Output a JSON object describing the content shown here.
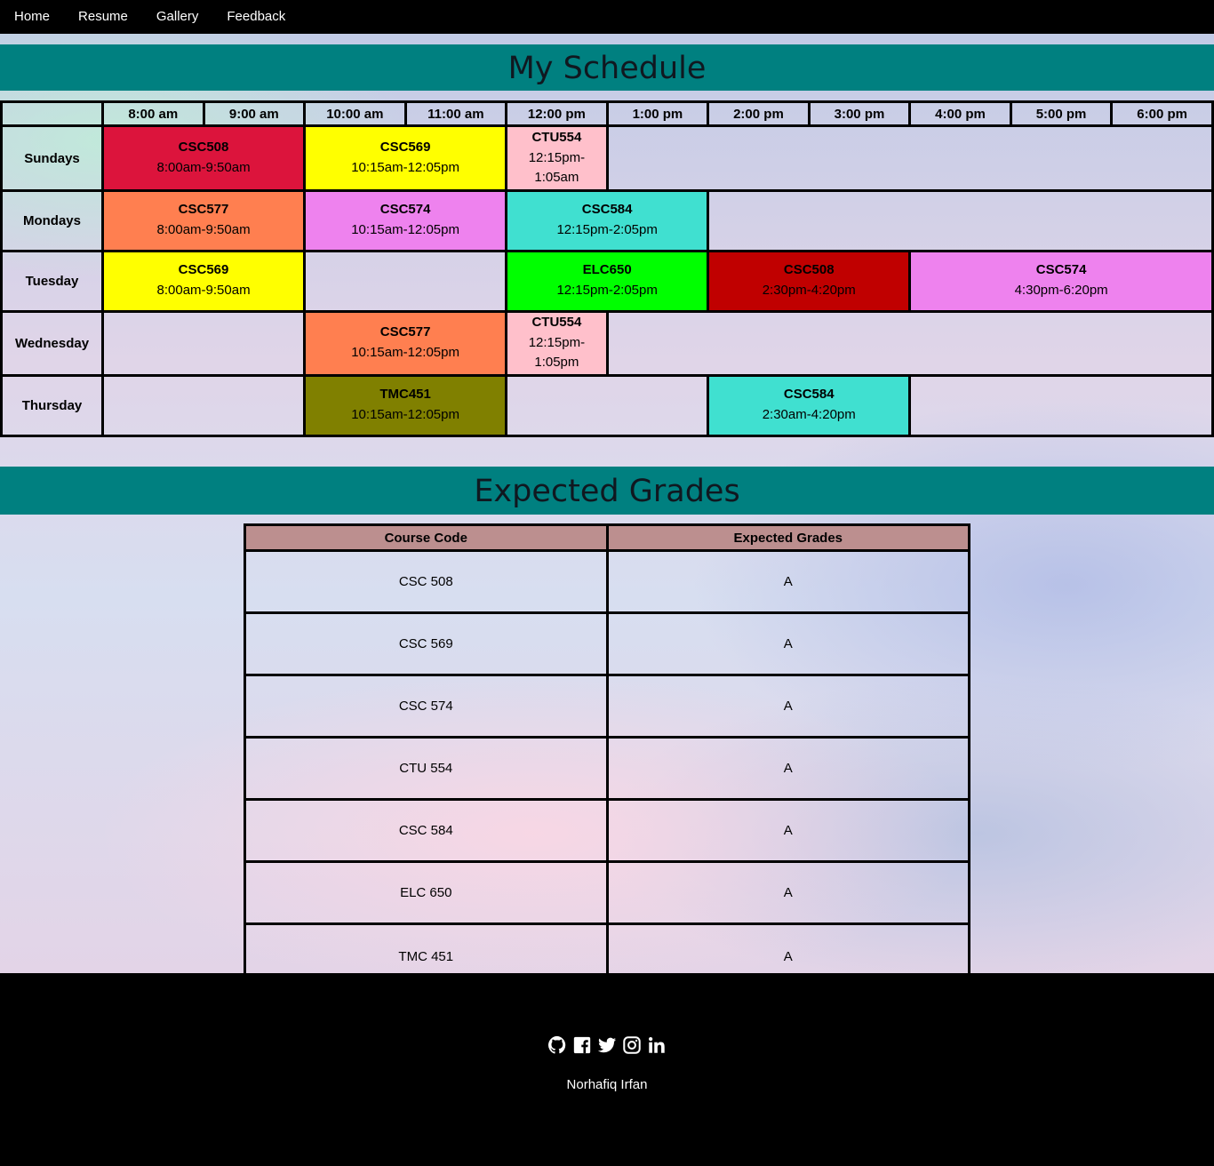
{
  "nav": {
    "items": [
      "Home",
      "Resume",
      "Gallery",
      "Feedback"
    ]
  },
  "schedule": {
    "title": "My Schedule",
    "times": [
      "8:00 am",
      "9:00 am",
      "10:00 am",
      "11:00 am",
      "12:00 pm",
      "1:00 pm",
      "2:00 pm",
      "3:00 pm",
      "4:00 pm",
      "5:00 pm",
      "6:00 pm"
    ],
    "days": [
      "Sundays",
      "Mondays",
      "Tuesday",
      "Wednesday",
      "Thursday"
    ],
    "classes": {
      "sun_csc508": {
        "code": "CSC508",
        "time": "8:00am-9:50am",
        "color": "#dc143c"
      },
      "sun_csc569": {
        "code": "CSC569",
        "time": "10:15am-12:05pm",
        "color": "#ffff00"
      },
      "sun_ctu554": {
        "code": "CTU554",
        "time": "12:15pm-1:05am",
        "color": "#ffc0cb"
      },
      "mon_csc577": {
        "code": "CSC577",
        "time": "8:00am-9:50am",
        "color": "#ff7f50"
      },
      "mon_csc574": {
        "code": "CSC574",
        "time": "10:15am-12:05pm",
        "color": "#ee82ee"
      },
      "mon_csc584": {
        "code": "CSC584",
        "time": "12:15pm-2:05pm",
        "color": "#40e0d0"
      },
      "tue_csc569": {
        "code": "CSC569",
        "time": "8:00am-9:50am",
        "color": "#ffff00"
      },
      "tue_elc650": {
        "code": "ELC650",
        "time": "12:15pm-2:05pm",
        "color": "#00ff00"
      },
      "tue_csc508": {
        "code": "CSC508",
        "time": "2:30pm-4:20pm",
        "color": "#c00000"
      },
      "tue_csc574": {
        "code": "CSC574",
        "time": "4:30pm-6:20pm",
        "color": "#ee82ee"
      },
      "wed_csc577": {
        "code": "CSC577",
        "time": "10:15am-12:05pm",
        "color": "#ff7f50"
      },
      "wed_ctu554": {
        "code": "CTU554",
        "time": "12:15pm-1:05pm",
        "color": "#ffc0cb"
      },
      "thu_tmc451": {
        "code": "TMC451",
        "time": "10:15am-12:05pm",
        "color": "#808000"
      },
      "thu_csc584": {
        "code": "CSC584",
        "time": "2:30am-4:20pm",
        "color": "#40e0d0"
      }
    }
  },
  "grades": {
    "title": "Expected Grades",
    "headers": [
      "Course Code",
      "Expected Grades"
    ],
    "rows": [
      {
        "course": "CSC 508",
        "grade": "A"
      },
      {
        "course": "CSC 569",
        "grade": "A"
      },
      {
        "course": "CSC 574",
        "grade": "A"
      },
      {
        "course": "CTU 554",
        "grade": "A"
      },
      {
        "course": "CSC 584",
        "grade": "A"
      },
      {
        "course": "ELC 650",
        "grade": "A"
      },
      {
        "course": "TMC 451",
        "grade": "A"
      }
    ]
  },
  "footer": {
    "icons": [
      "github-icon",
      "facebook-icon",
      "twitter-icon",
      "instagram-icon",
      "linkedin-icon"
    ],
    "author": "Norhafiq Irfan"
  }
}
